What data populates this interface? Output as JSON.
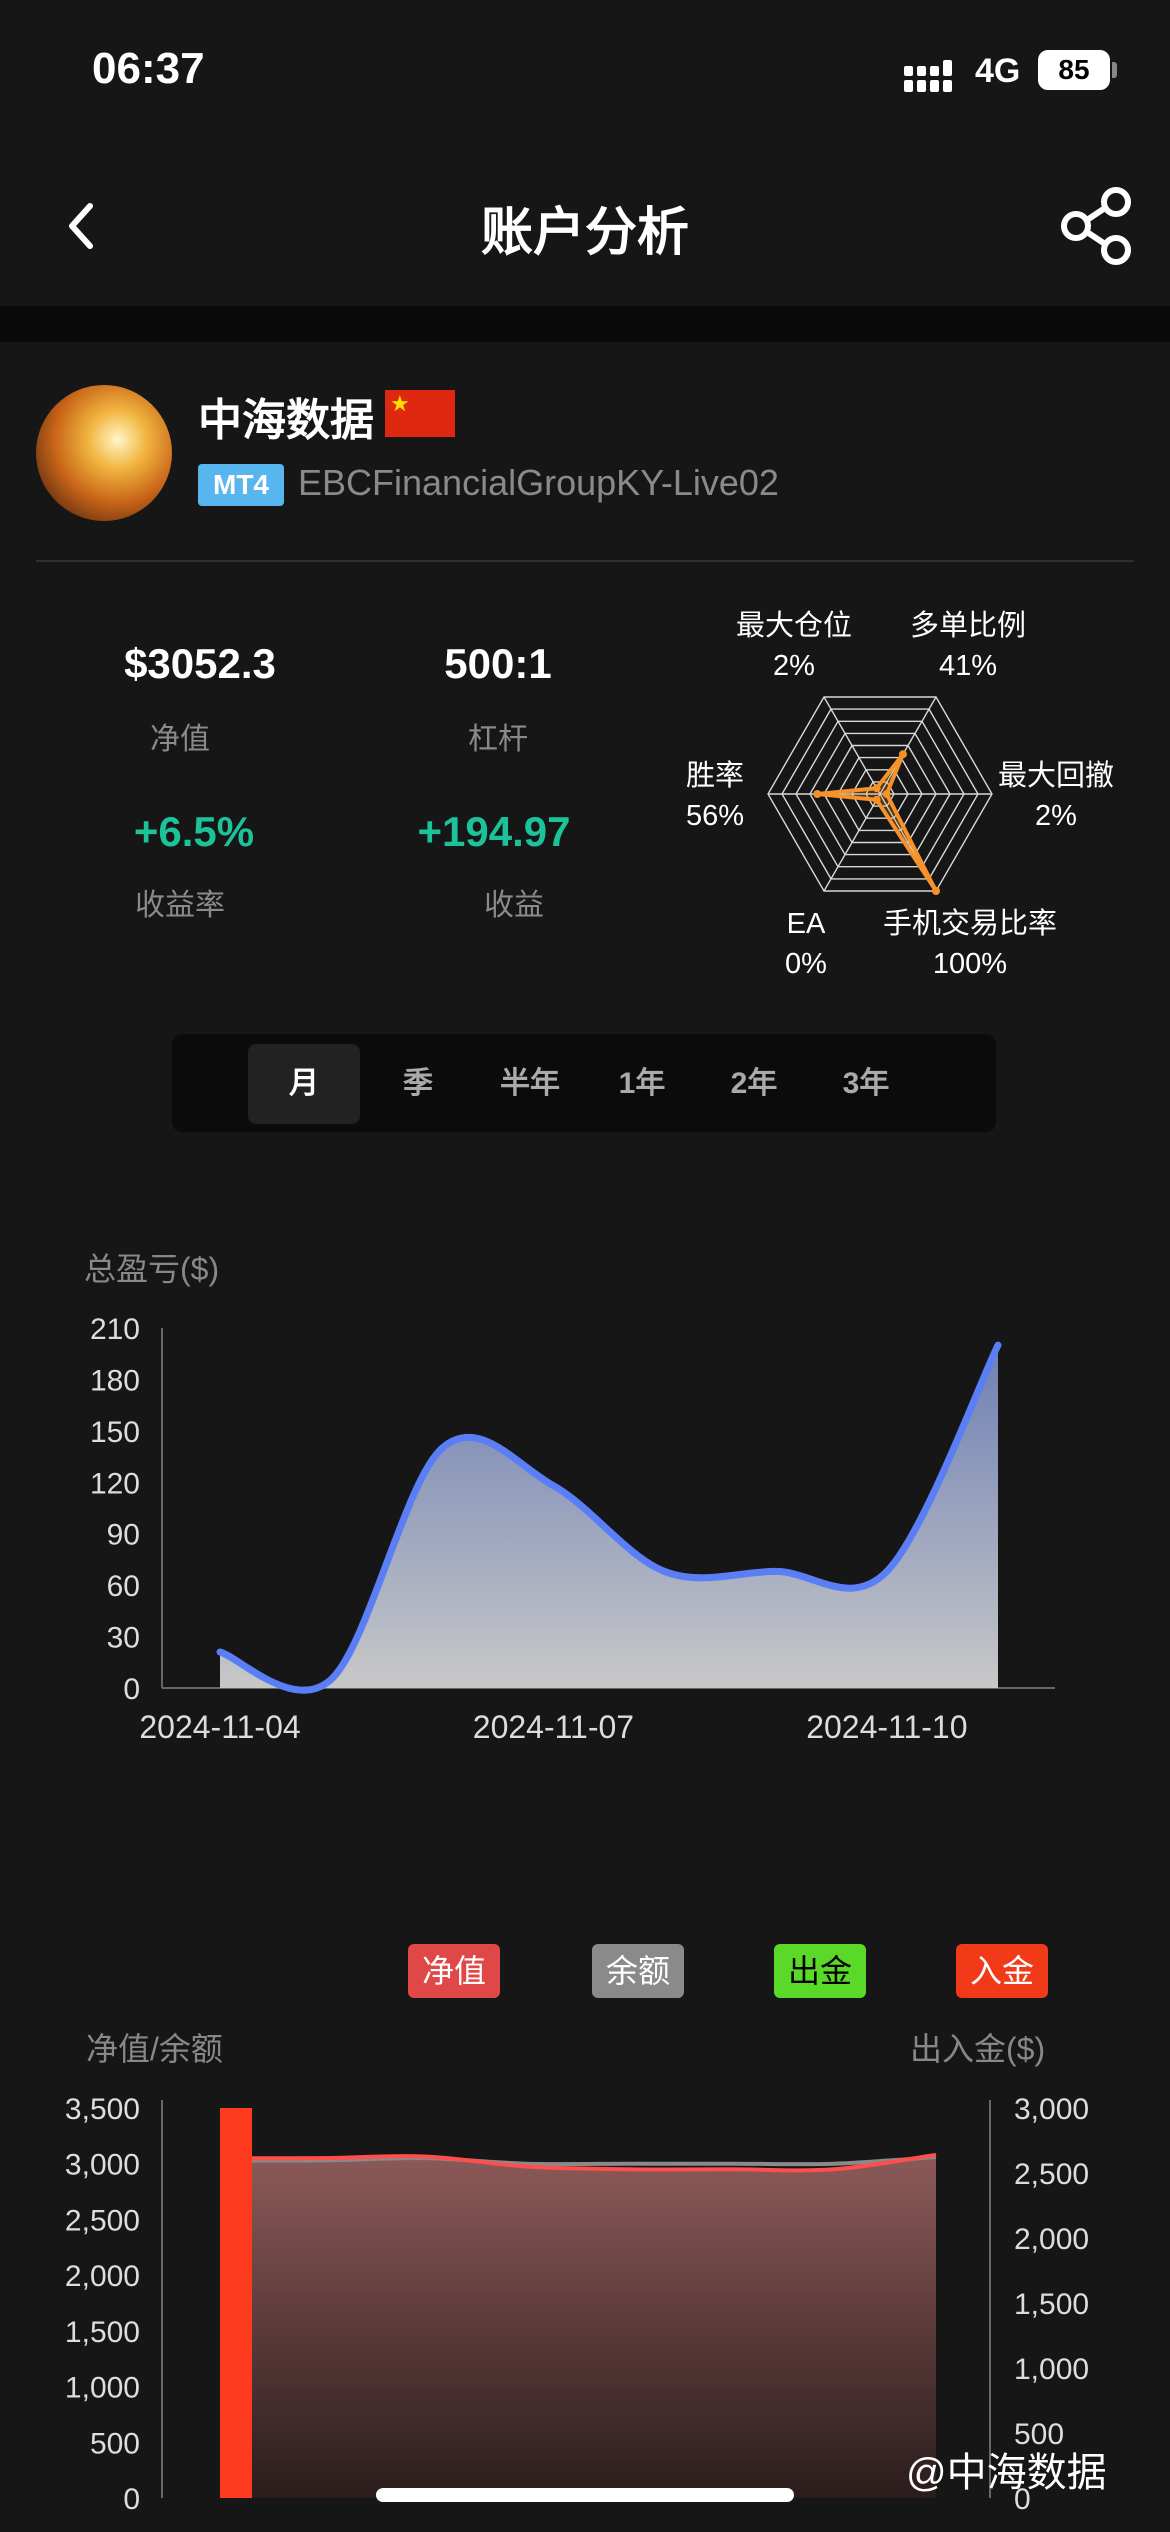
{
  "status_bar": {
    "time": "06:37",
    "network": "4G",
    "battery": "85"
  },
  "nav": {
    "title": "账户分析"
  },
  "profile": {
    "name": "中海数据",
    "platform_badge": "MT4",
    "account": "EBCFinancialGroupKY-Live02"
  },
  "stats": [
    {
      "value": "$3052.3",
      "label": "净值"
    },
    {
      "value": "500:1",
      "label": "杠杆"
    },
    {
      "value": "+6.5%",
      "label": "收益率"
    },
    {
      "value": "+194.97",
      "label": "收益"
    }
  ],
  "radar": {
    "axes": [
      {
        "name": "最大仓位",
        "value": "2%",
        "level": 0.02
      },
      {
        "name": "多单比例",
        "value": "41%",
        "level": 0.41
      },
      {
        "name": "最大回撤",
        "value": "2%",
        "level": 0.02
      },
      {
        "name": "手机交易比率",
        "value": "100%",
        "level": 1.0
      },
      {
        "name": "EA",
        "value": "0%",
        "level": 0.0
      },
      {
        "name": "胜率",
        "value": "56%",
        "level": 0.56
      }
    ],
    "color": "#f5922a"
  },
  "periods": {
    "items": [
      "月",
      "季",
      "半年",
      "1年",
      "2年",
      "3年"
    ],
    "active": "月"
  },
  "chart_data": [
    {
      "type": "area",
      "ylabel": "总盈亏($)",
      "ylim": [
        0,
        210
      ],
      "yticks": [
        "210",
        "180",
        "150",
        "120",
        "90",
        "60",
        "30",
        "0"
      ],
      "xticks": [
        "2024-11-04",
        "2024-11-07",
        "2024-11-10"
      ],
      "x": [
        "2024-11-04",
        "2024-11-05",
        "2024-11-06",
        "2024-11-07",
        "2024-11-08",
        "2024-11-09",
        "2024-11-10",
        "2024-11-11"
      ],
      "series": [
        {
          "values": [
            21,
            5,
            140,
            118,
            68,
            68,
            68,
            200
          ]
        }
      ],
      "line_color": "#5a7ef5"
    },
    {
      "type": "area",
      "ylabel_left": "净值/余额",
      "ylabel_right": "出入金($)",
      "ylim_left": [
        0,
        3500
      ],
      "ylim_right": [
        0,
        3000
      ],
      "yticks_left": [
        "3,500",
        "3,000",
        "2,500",
        "2,000",
        "1,500",
        "1,000",
        "500",
        "0"
      ],
      "yticks_right": [
        "3,000",
        "2,500",
        "2,000",
        "1,500",
        "1,000",
        "500",
        "0"
      ],
      "legend": [
        {
          "name": "净值",
          "color": "#ff4e4e",
          "bg": "#e04848"
        },
        {
          "name": "余额",
          "color": "#8a8a8a",
          "bg": "#8a8a8a"
        },
        {
          "name": "出金",
          "color": "#4fd91d",
          "bg": "#5ad928"
        },
        {
          "name": "入金",
          "color": "#ff3b1f",
          "bg": "#f03a18"
        }
      ],
      "x": [
        "2024-11-04",
        "2024-11-05",
        "2024-11-06",
        "2024-11-07",
        "2024-11-08",
        "2024-11-09",
        "2024-11-10",
        "2024-11-11"
      ],
      "series": [
        {
          "name": "净值",
          "values": [
            3050,
            3050,
            3065,
            2975,
            2950,
            2950,
            2950,
            3080
          ]
        },
        {
          "name": "余额",
          "values": [
            3030,
            3030,
            3050,
            3000,
            3000,
            3000,
            3000,
            3060
          ]
        }
      ],
      "bars": [
        {
          "name": "入金",
          "x": "2024-11-04",
          "value": 3000
        },
        {
          "name": "出金",
          "x": "2024-11-06",
          "value": 60
        }
      ]
    }
  ],
  "watermark": "@中海数据"
}
